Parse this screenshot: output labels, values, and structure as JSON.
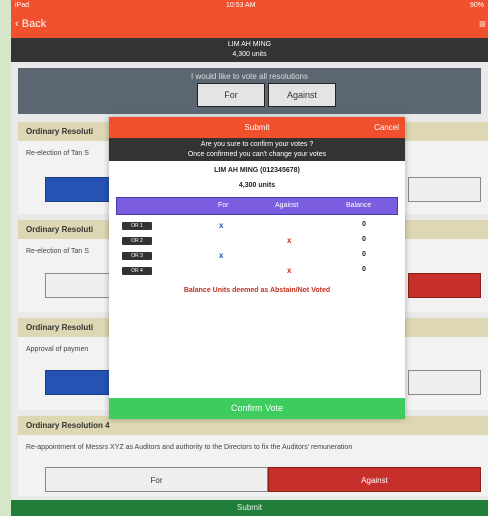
{
  "status_bar": {
    "device": "iPad",
    "time": "10:53 AM",
    "battery": "90%"
  },
  "nav": {
    "back_label": "Back",
    "menu_icon": "menu-icon"
  },
  "voter": {
    "name": "LIM AH MING",
    "units": "4,300 units"
  },
  "vote_all": {
    "prompt": "I would like to vote all resolutions",
    "for_label": "For",
    "against_label": "Against"
  },
  "resolutions": [
    {
      "title": "Ordinary Resoluti",
      "desc": "Re-election of Tan S"
    },
    {
      "title": "Ordinary Resoluti",
      "desc": "Re-election of Tan S"
    },
    {
      "title": "Ordinary Resoluti",
      "desc": "Approval of paymen"
    },
    {
      "title": "Ordinary Resolution 4",
      "desc": "Re-appointment of Messrs XYZ as Auditors and authority to the Directors to fix the Auditors' remuneration",
      "for_label": "For",
      "against_label": "Against"
    }
  ],
  "modal": {
    "title": "Submit",
    "cancel_label": "Cancel",
    "warning_line1": "Are you sure to confirm your votes ?",
    "warning_line2": "Once confirmed you can't change your votes",
    "voter_name": "LIM AH MING (012345678)",
    "voter_units": "4,300 units",
    "columns": [
      "For",
      "Against",
      "Balance"
    ],
    "rows": [
      {
        "label": "OR 1",
        "for": "x",
        "against": "",
        "balance": "0"
      },
      {
        "label": "OR 2",
        "for": "",
        "against": "x",
        "balance": "0"
      },
      {
        "label": "OR 3",
        "for": "x",
        "against": "",
        "balance": "0"
      },
      {
        "label": "OR 4",
        "for": "",
        "against": "x",
        "balance": "0"
      }
    ],
    "note": "Balance Units deemed as Abstain/Not Voted",
    "confirm_label": "Confirm Vote"
  },
  "submit_label": "Submit",
  "colors": {
    "accent": "#f0502e",
    "for_blue": "#2453b3",
    "against_red": "#c7302a",
    "confirm_green": "#3ecc5e",
    "submit_green": "#1f7d39",
    "table_header": "#7b5ee0"
  }
}
